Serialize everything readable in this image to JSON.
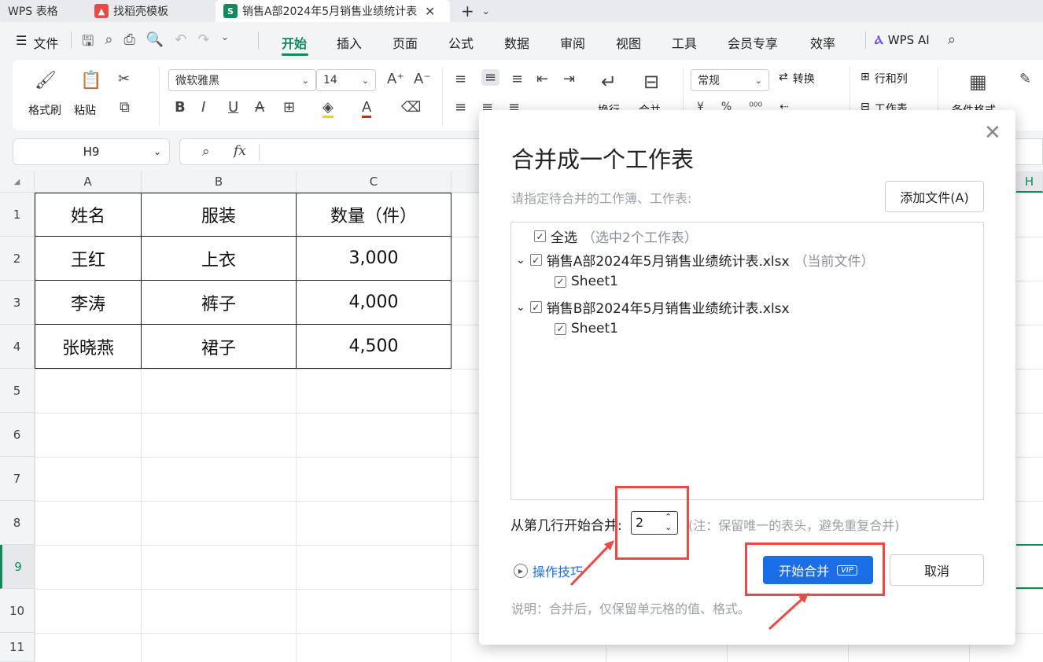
{
  "tabs": [
    {
      "label": "WPS 表格"
    },
    {
      "label": "找稻壳模板"
    },
    {
      "label": "销售A部2024年5月销售业绩统计表"
    }
  ],
  "menu": {
    "file": "文件",
    "items": [
      "开始",
      "插入",
      "页面",
      "公式",
      "数据",
      "审阅",
      "视图",
      "工具",
      "会员专享",
      "效率"
    ],
    "ai": "WPS AI"
  },
  "ribbon": {
    "format_painter": "格式刷",
    "paste": "粘贴",
    "font_name": "微软雅黑",
    "font_size": "14",
    "wrap": "换行",
    "merge": "合并",
    "number_format": "常规",
    "convert": "转换",
    "rows_cols": "行和列",
    "worksheet": "工作表",
    "cond_format": "条件格式"
  },
  "formula": {
    "name_box": "H9",
    "fx": "fx"
  },
  "sheet": {
    "columns": [
      "A",
      "B",
      "C",
      "H"
    ],
    "rows": [
      "1",
      "2",
      "3",
      "4",
      "5",
      "6",
      "7",
      "8",
      "9",
      "10",
      "11"
    ],
    "table": [
      [
        "姓名",
        "服装",
        "数量（件）"
      ],
      [
        "王红",
        "上衣",
        "3,000"
      ],
      [
        "李涛",
        "裤子",
        "4,000"
      ],
      [
        "张晓燕",
        "裙子",
        "4,500"
      ]
    ]
  },
  "dialog": {
    "title": "合并成一个工作表",
    "prompt": "请指定待合并的工作簿、工作表:",
    "add_file": "添加文件(A)",
    "select_all": "全选",
    "select_all_note": "（选中2个工作表）",
    "files": [
      {
        "name": "销售A部2024年5月销售业绩统计表.xlsx",
        "note": "（当前文件）",
        "sheet": "Sheet1"
      },
      {
        "name": "销售B部2024年5月销售业绩统计表.xlsx",
        "note": "",
        "sheet": "Sheet1"
      }
    ],
    "start_row_label": "从第几行开始合并:",
    "start_row_value": "2",
    "start_row_note": "(注：保留唯一的表头，避免重复合并)",
    "tips": "操作技巧",
    "start_button": "开始合并",
    "vip": "VIP",
    "cancel": "取消",
    "footer": "说明：合并后，仅保留单元格的值、格式。"
  },
  "colors": {
    "accent": "#118a5a",
    "primary_button": "#1a6ee8",
    "annotation": "#e84a4a"
  }
}
